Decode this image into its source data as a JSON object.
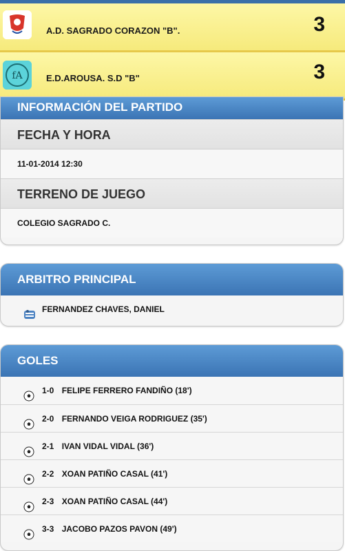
{
  "match": {
    "home": {
      "name": "A.D. SAGRADO CORAZON \"B\".",
      "score": "3"
    },
    "away": {
      "name": "E.D.AROUSA. S.D \"B\"",
      "score": "3"
    }
  },
  "info": {
    "title": "INFORMACIÓN DEL PARTIDO",
    "date_label": "FECHA Y HORA",
    "date_value": "11-01-2014 12:30",
    "field_label": "TERRENO DE JUEGO",
    "field_value": "COLEGIO SAGRADO C."
  },
  "referee": {
    "title": "ARBITRO PRINCIPAL",
    "name": "FERNANDEZ CHAVES, DANIEL"
  },
  "goals": {
    "title": "GOLES",
    "items": [
      {
        "score": "1-0",
        "player": "FELIPE FERRERO FANDIÑO (18')"
      },
      {
        "score": "2-0",
        "player": "FERNANDO VEIGA RODRIGUEZ (35')"
      },
      {
        "score": "2-1",
        "player": "IVAN VIDAL VIDAL (36')"
      },
      {
        "score": "2-2",
        "player": "XOAN PATIÑO CASAL (41')"
      },
      {
        "score": "2-3",
        "player": "XOAN PATIÑO CASAL (44')"
      },
      {
        "score": "3-3",
        "player": "JACOBO PAZOS PAVON (49')"
      }
    ]
  },
  "colors": {
    "header_blue": "#3b74b4",
    "team_bar_yellow": "#fdf7a6"
  }
}
